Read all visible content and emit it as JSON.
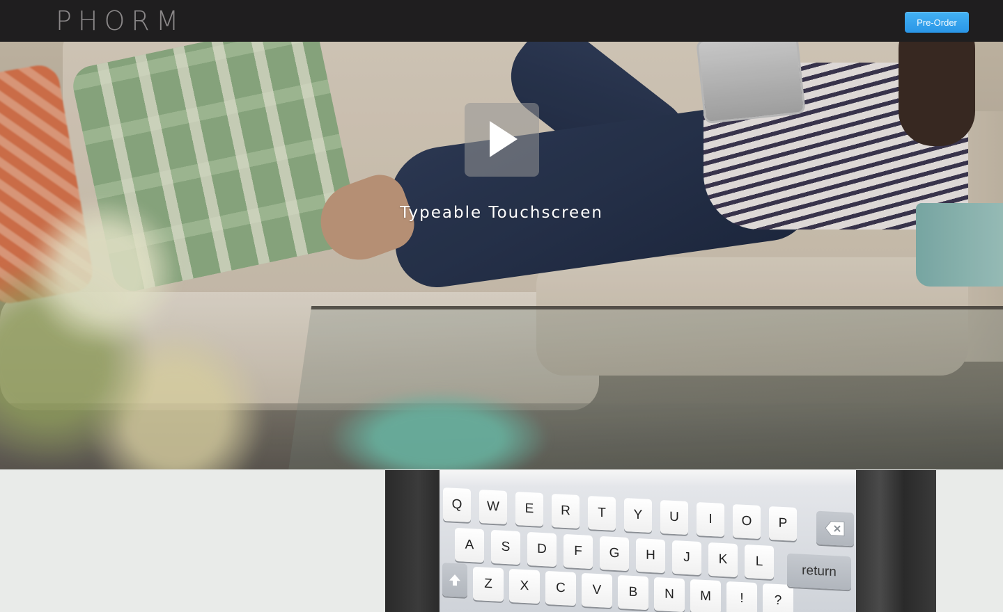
{
  "header": {
    "logo_text": "PHORM",
    "preorder_label": "Pre-Order"
  },
  "hero": {
    "title": "Typeable Touchscreen",
    "play_icon": "play-icon"
  },
  "keyboard": {
    "row1": [
      "Q",
      "W",
      "E",
      "R",
      "T",
      "Y",
      "U",
      "I",
      "O",
      "P"
    ],
    "row2": [
      "A",
      "S",
      "D",
      "F",
      "G",
      "H",
      "J",
      "K",
      "L"
    ],
    "row3": [
      "Z",
      "X",
      "C",
      "V",
      "B",
      "N",
      "M",
      "!",
      "?"
    ],
    "return_label": "return",
    "icons": [
      "backspace-icon",
      "shift-icon"
    ]
  },
  "colors": {
    "header_bg": "#1f1e1f",
    "button_bg": "#2a96e7",
    "page_bg": "#e9ebe9"
  }
}
